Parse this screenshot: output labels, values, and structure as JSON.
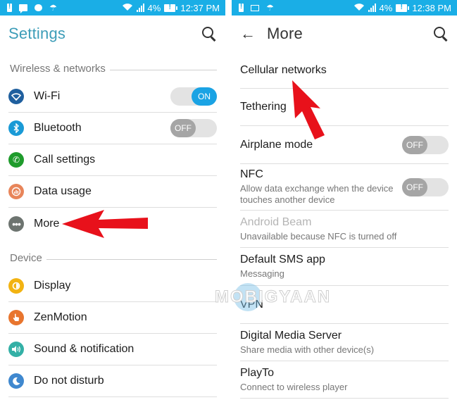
{
  "left": {
    "status_bar": {
      "left_icons": [
        "battery-alert-icon",
        "message-icon",
        "chat-icon",
        "umbrella-weather-icon"
      ],
      "battery_percent": "4%",
      "time": "12:37 PM"
    },
    "app_bar": {
      "title": "Settings",
      "search_icon": "search-icon"
    },
    "sections": [
      {
        "header": "Wireless & networks",
        "items": [
          {
            "label": "Wi-Fi",
            "icon": "wifi-icon",
            "icon_color": "#1f5f9e",
            "toggle": "ON"
          },
          {
            "label": "Bluetooth",
            "icon": "bluetooth-icon",
            "icon_color": "#1a9ad6",
            "toggle": "OFF"
          },
          {
            "label": "Call settings",
            "icon": "phone-icon",
            "icon_color": "#1f9b2c"
          },
          {
            "label": "Data usage",
            "icon": "data-usage-icon",
            "icon_color": "#e8855a"
          },
          {
            "label": "More",
            "icon": "more-dots-icon",
            "icon_color": "#6d7470"
          }
        ]
      },
      {
        "header": "Device",
        "items": [
          {
            "label": "Display",
            "icon": "display-brightness-icon",
            "icon_color": "#f2b312"
          },
          {
            "label": "ZenMotion",
            "icon": "zenmotion-hand-icon",
            "icon_color": "#e8752e"
          },
          {
            "label": "Sound & notification",
            "icon": "sound-icon",
            "icon_color": "#33b0a6"
          },
          {
            "label": "Do not disturb",
            "icon": "moon-icon",
            "icon_color": "#3f88cf"
          }
        ]
      }
    ]
  },
  "right": {
    "status_bar": {
      "left_icons": [
        "battery-alert-icon",
        "image-icon",
        "umbrella-weather-icon"
      ],
      "battery_percent": "4%",
      "time": "12:38 PM"
    },
    "app_bar": {
      "title": "More",
      "back_icon": "back-arrow-icon",
      "search_icon": "search-icon"
    },
    "items": [
      {
        "title": "Cellular networks"
      },
      {
        "title": "Tethering"
      },
      {
        "title": "Airplane mode",
        "toggle": "OFF"
      },
      {
        "title": "NFC",
        "subtitle": "Allow data exchange when the device touches another device",
        "toggle": "OFF"
      },
      {
        "title": "Android Beam",
        "subtitle": "Unavailable because NFC is turned off",
        "disabled": true
      },
      {
        "title": "Default SMS app",
        "subtitle": "Messaging"
      },
      {
        "title": "VPN"
      },
      {
        "title": "Digital Media Server",
        "subtitle": "Share media with other device(s)"
      },
      {
        "title": "PlayTo",
        "subtitle": "Connect to wireless player"
      }
    ]
  },
  "annotations": {
    "arrow_color": "#e8111b",
    "watermark": "MOBIGYAAN"
  },
  "theme": {
    "status_bar_color": "#1aaee6",
    "toggle_on_color": "#1aa3e4",
    "toggle_off_color": "#a5a5a5"
  }
}
